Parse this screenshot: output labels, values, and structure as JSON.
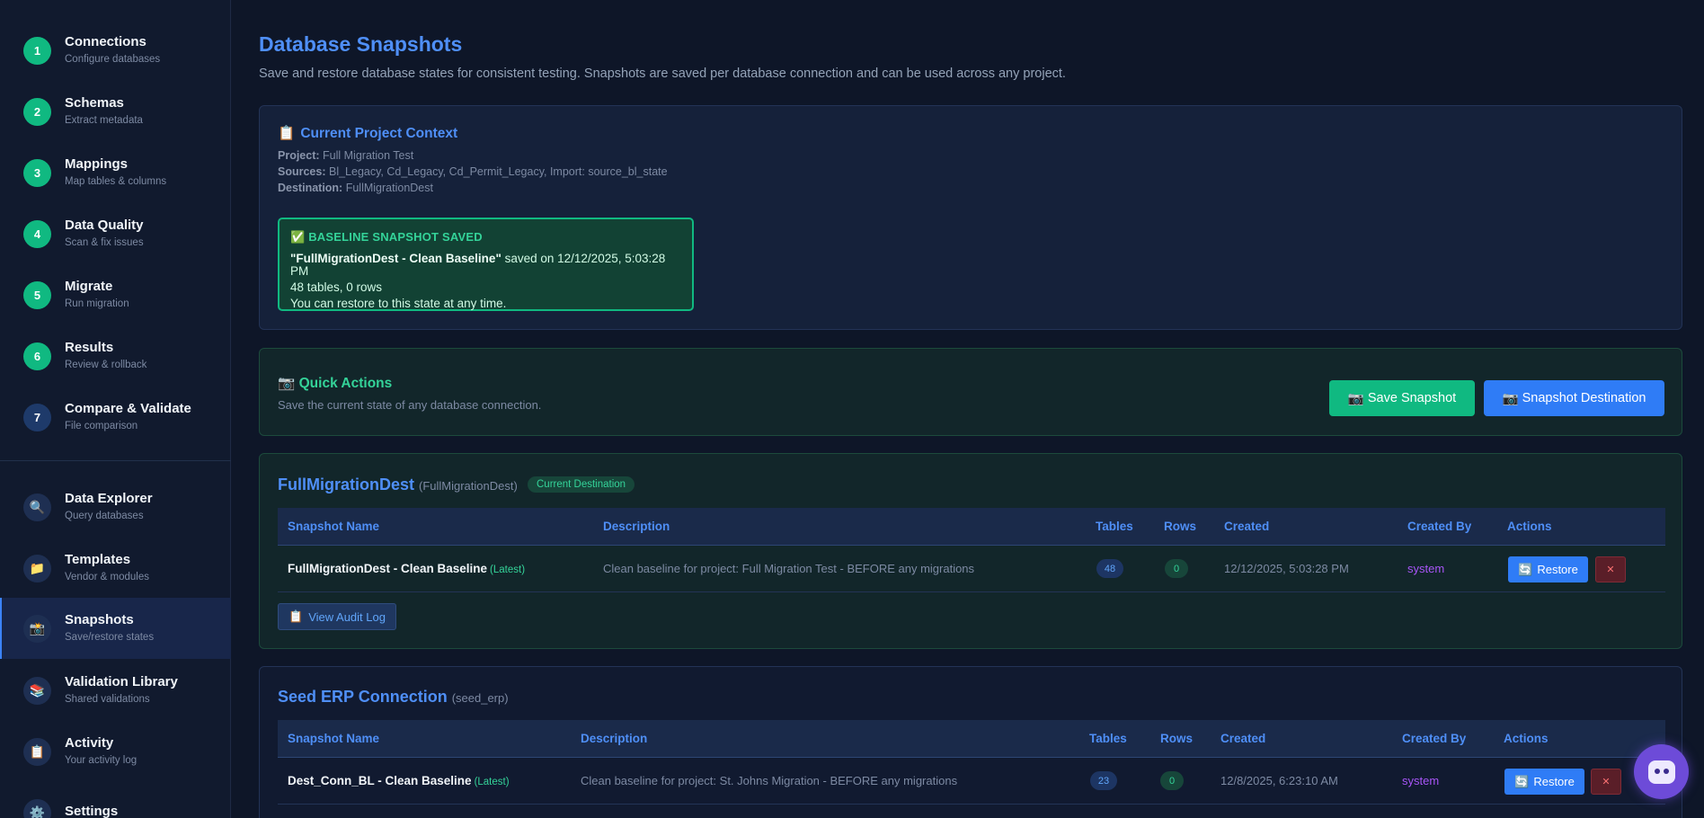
{
  "sidebar": {
    "steps": [
      {
        "num": "1",
        "title": "Connections",
        "sub": "Configure databases"
      },
      {
        "num": "2",
        "title": "Schemas",
        "sub": "Extract metadata"
      },
      {
        "num": "3",
        "title": "Mappings",
        "sub": "Map tables & columns"
      },
      {
        "num": "4",
        "title": "Data Quality",
        "sub": "Scan & fix issues"
      },
      {
        "num": "5",
        "title": "Migrate",
        "sub": "Run migration"
      },
      {
        "num": "6",
        "title": "Results",
        "sub": "Review & rollback"
      },
      {
        "num": "7",
        "title": "Compare & Validate",
        "sub": "File comparison"
      }
    ],
    "tools": [
      {
        "icon": "🔍",
        "title": "Data Explorer",
        "sub": "Query databases"
      },
      {
        "icon": "📁",
        "title": "Templates",
        "sub": "Vendor & modules"
      },
      {
        "icon": "📸",
        "title": "Snapshots",
        "sub": "Save/restore states"
      },
      {
        "icon": "📚",
        "title": "Validation Library",
        "sub": "Shared validations"
      },
      {
        "icon": "📋",
        "title": "Activity",
        "sub": "Your activity log"
      },
      {
        "icon": "⚙️",
        "title": "Settings",
        "sub": ""
      }
    ]
  },
  "page": {
    "title": "Database Snapshots",
    "description": "Save and restore database states for consistent testing. Snapshots are saved per database connection and can be used across any project."
  },
  "context": {
    "icon": "📋",
    "title": "Current Project Context",
    "project_label": "Project:",
    "project": "Full Migration Test",
    "sources_label": "Sources:",
    "sources": "Bl_Legacy, Cd_Legacy, Cd_Permit_Legacy, Import: source_bl_state",
    "destination_label": "Destination:",
    "destination": "FullMigrationDest",
    "baseline": {
      "icon": "✅",
      "heading": "BASELINE SNAPSHOT SAVED",
      "name": "\"FullMigrationDest - Clean Baseline\"",
      "saved_text": "saved on 12/12/2025, 5:03:28 PM",
      "stats": "48 tables, 0 rows",
      "note": "You can restore to this state at any time."
    }
  },
  "quick_actions": {
    "icon": "📷",
    "title": "Quick Actions",
    "subtitle": "Save the current state of any database connection.",
    "save_label": "Save Snapshot",
    "dest_label": "Snapshot Destination",
    "btn_icon": "📷"
  },
  "table_headers": {
    "name": "Snapshot Name",
    "description": "Description",
    "tables": "Tables",
    "rows": "Rows",
    "created": "Created",
    "created_by": "Created By",
    "actions": "Actions"
  },
  "databases": [
    {
      "name": "FullMigrationDest",
      "key": "(FullMigrationDest)",
      "badge": "Current Destination",
      "audit_label": "View Audit Log",
      "audit_icon": "📋",
      "snapshots": [
        {
          "name": "FullMigrationDest - Clean Baseline",
          "latest": "(Latest)",
          "description": "Clean baseline for project: Full Migration Test - BEFORE any migrations",
          "tables": "48",
          "rows": "0",
          "created": "12/12/2025, 5:03:28 PM",
          "created_by": "system",
          "restore_label": "Restore",
          "restore_icon": "🔄",
          "delete_icon": "✕"
        }
      ]
    },
    {
      "name": "Seed ERP Connection",
      "key": "(seed_erp)",
      "snapshots": [
        {
          "name": "Dest_Conn_BL - Clean Baseline",
          "latest": "(Latest)",
          "description": "Clean baseline for project: St. Johns Migration - BEFORE any migrations",
          "tables": "23",
          "rows": "0",
          "created": "12/8/2025, 6:23:10 AM",
          "created_by": "system",
          "restore_label": "Restore",
          "restore_icon": "🔄",
          "delete_icon": "✕"
        }
      ]
    }
  ],
  "assistant": {
    "icon": "robot-icon"
  }
}
